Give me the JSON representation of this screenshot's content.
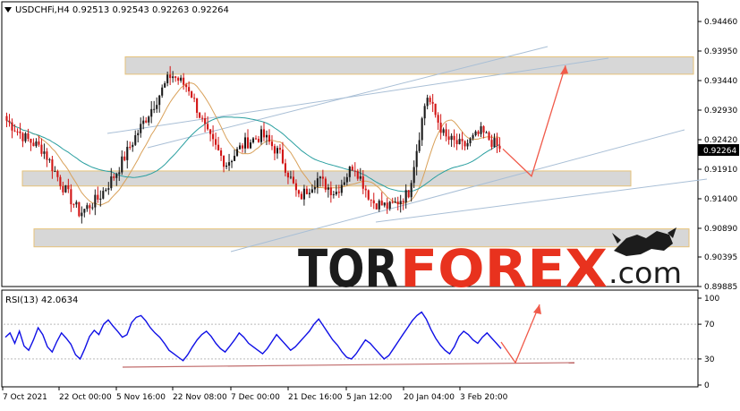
{
  "header": {
    "label": "USDCHFi,H4 0.92513 0.92543 0.92263 0.92264"
  },
  "rsi_header": {
    "label": "RSI(13) 42.0634"
  },
  "current_price_label": "0.92264",
  "price_axis": {
    "ticks": [
      "0.94460",
      "0.93950",
      "0.93440",
      "0.92930",
      "0.92420",
      "0.91910",
      "0.91400",
      "0.90890",
      "0.90395",
      "0.89885"
    ],
    "ylim": [
      0.89885,
      0.9446
    ]
  },
  "rsi_axis": {
    "ticks": [
      "100",
      "70",
      "30",
      "0"
    ],
    "ylim": [
      0,
      100
    ]
  },
  "time_axis": {
    "labels": [
      "7 Oct 2021",
      "22 Oct 00:00",
      "5 Nov 16:00",
      "22 Nov 08:00",
      "7 Dec 00:00",
      "21 Dec 16:00",
      "5 Jan 12:00",
      "20 Jan 04:00",
      "3 Feb 20:00"
    ]
  },
  "logo": {
    "tor": "TOR",
    "forex": "FOREX",
    "dotcom": ".com"
  },
  "colors": {
    "bull": "#1a1a1a",
    "bear": "#d21414",
    "ma_fast": "#d9a15a",
    "ma_slow": "#2a9fa0",
    "zone_fill": "#d7d7d7",
    "zone_border": "#e6c27a",
    "trendline": "#a9bfd6",
    "forecast_arrow": "#f05a4a",
    "rsi_line": "#1010e6",
    "rsi_support": "#c06b6b",
    "logo_dark": "#1c1c1c",
    "logo_red": "#e8321e"
  },
  "chart_data": [
    {
      "type": "candlestick",
      "symbol": "USDCHFi",
      "timeframe": "H4",
      "ohlc_last": {
        "open": 0.92513,
        "high": 0.92543,
        "low": 0.92263,
        "close": 0.92264
      },
      "ylim": [
        0.89885,
        0.9446
      ],
      "close_path": [
        [
          "7 Oct 2021",
          0.9275
        ],
        [
          "12 Oct",
          0.9245
        ],
        [
          "17 Oct",
          0.9225
        ],
        [
          "22 Oct 00:00",
          0.9165
        ],
        [
          "27 Oct",
          0.9115
        ],
        [
          "1 Nov",
          0.914
        ],
        [
          "5 Nov 16:00",
          0.9185
        ],
        [
          "10 Nov",
          0.9245
        ],
        [
          "15 Nov",
          0.93
        ],
        [
          "18 Nov",
          0.9355
        ],
        [
          "22 Nov 08:00",
          0.933
        ],
        [
          "26 Nov",
          0.925
        ],
        [
          "1 Dec",
          0.92
        ],
        [
          "7 Dec 00:00",
          0.9235
        ],
        [
          "12 Dec",
          0.925
        ],
        [
          "16 Dec",
          0.9215
        ],
        [
          "21 Dec 16:00",
          0.914
        ],
        [
          "26 Dec",
          0.9175
        ],
        [
          "31 Dec",
          0.915
        ],
        [
          "5 Jan 12:00",
          0.92
        ],
        [
          "10 Jan",
          0.9135
        ],
        [
          "15 Jan",
          0.9125
        ],
        [
          "20 Jan 04:00",
          0.915
        ],
        [
          "25 Jan",
          0.932
        ],
        [
          "29 Jan",
          0.9245
        ],
        [
          "3 Feb 20:00",
          0.923
        ],
        [
          "6 Feb",
          0.9255
        ],
        [
          "9 Feb",
          0.9226
        ]
      ],
      "support_resistance_zones": [
        [
          0.9355,
          0.9385
        ],
        [
          0.9162,
          0.9188
        ],
        [
          0.9057,
          0.9088
        ]
      ],
      "forecast": [
        {
          "from": 0.9226,
          "to": 0.9179
        },
        {
          "from": 0.9179,
          "to": 0.937
        }
      ]
    },
    {
      "type": "line",
      "indicator": "RSI(13)",
      "last_value": 42.0634,
      "ylim": [
        0,
        100
      ],
      "levels": [
        70,
        30
      ],
      "values": [
        55,
        60,
        48,
        62,
        45,
        40,
        52,
        66,
        58,
        44,
        38,
        50,
        60,
        54,
        47,
        35,
        30,
        42,
        56,
        63,
        58,
        70,
        75,
        68,
        62,
        55,
        58,
        72,
        78,
        80,
        74,
        66,
        60,
        55,
        48,
        40,
        36,
        32,
        28,
        35,
        44,
        52,
        58,
        62,
        56,
        48,
        42,
        38,
        45,
        52,
        60,
        55,
        48,
        44,
        40,
        36,
        42,
        50,
        58,
        52,
        46,
        40,
        44,
        50,
        56,
        62,
        70,
        76,
        68,
        60,
        52,
        46,
        38,
        32,
        30,
        36,
        44,
        52,
        48,
        42,
        36,
        30,
        34,
        42,
        50,
        58,
        66,
        74,
        80,
        84,
        76,
        64,
        54,
        46,
        40,
        36,
        44,
        56,
        62,
        58,
        52,
        48,
        55,
        60,
        54,
        48,
        42
      ]
    }
  ]
}
